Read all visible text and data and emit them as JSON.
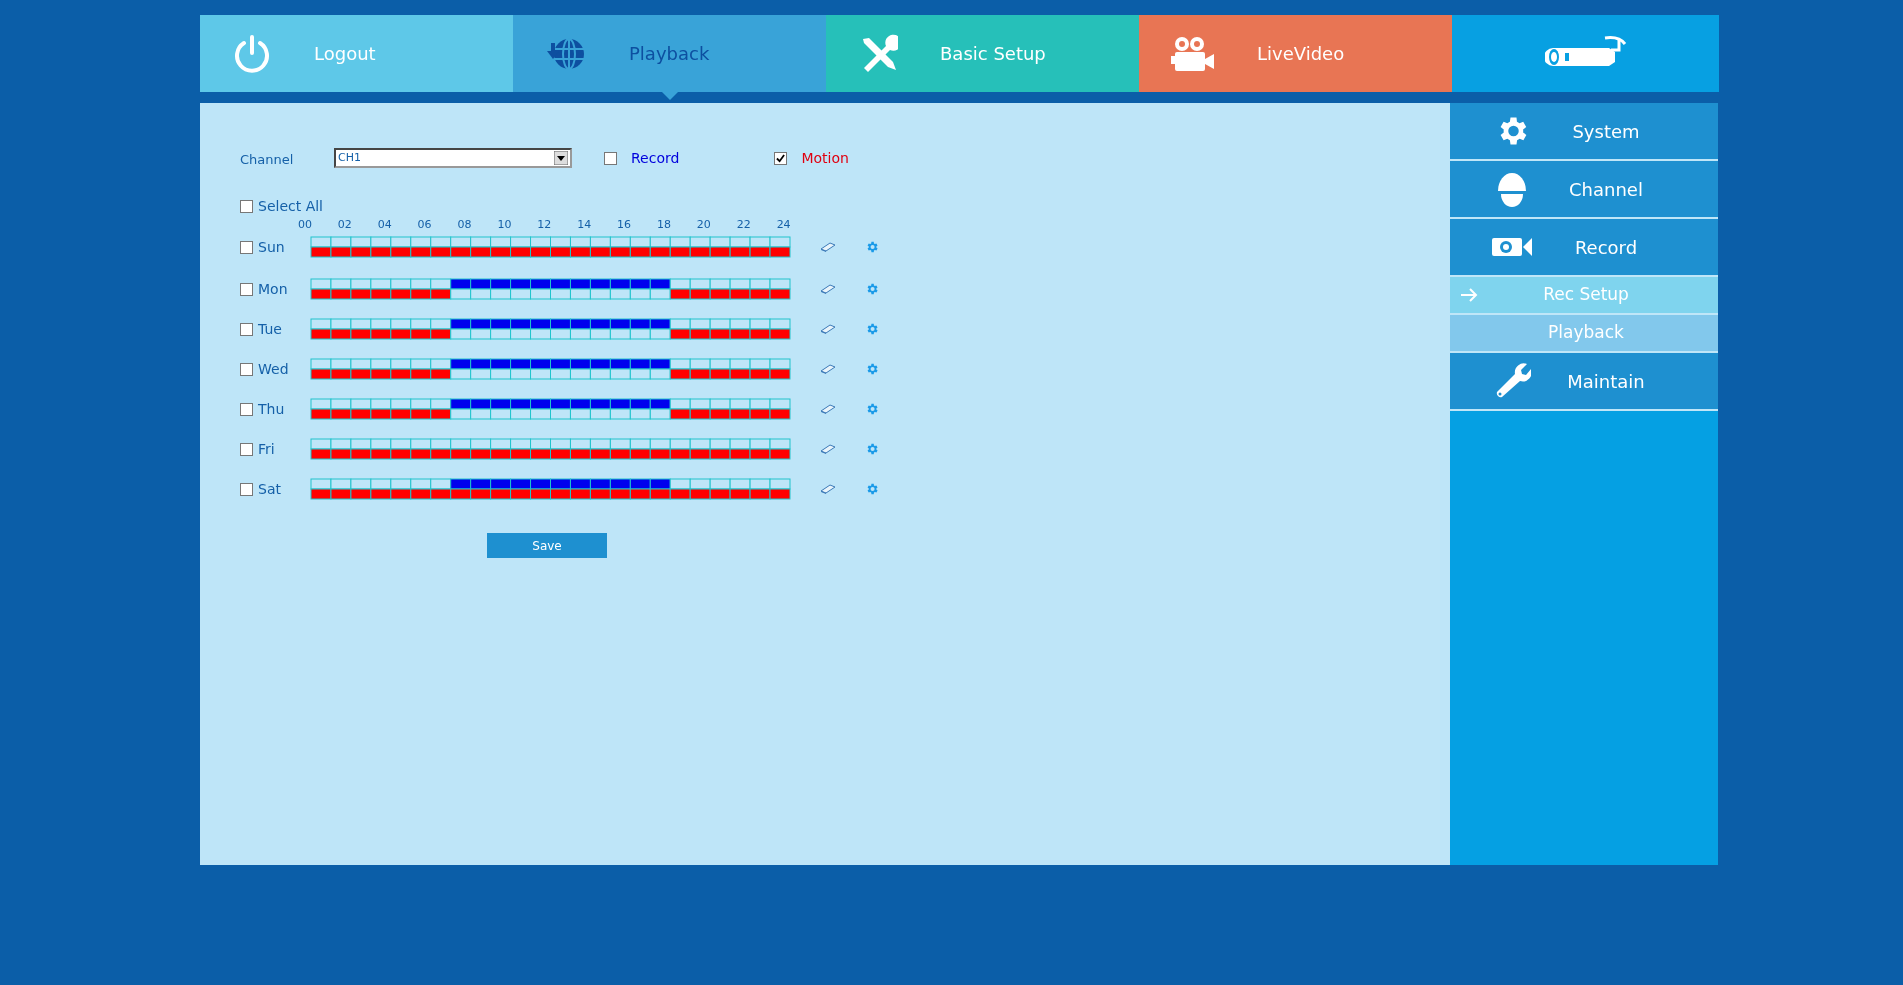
{
  "tabs": [
    {
      "label": "Logout",
      "selected": false,
      "color": "#5ec8e8"
    },
    {
      "label": "Playback",
      "selected": true,
      "color": "#39a3d8"
    },
    {
      "label": "Basic Setup",
      "selected": false,
      "color": "#26c0b9"
    },
    {
      "label": "LiveVideo",
      "selected": false,
      "color": "#e87554"
    },
    {
      "selected": false,
      "color": "#07a0e2"
    }
  ],
  "channel": {
    "label": "Channel",
    "value": "CH1"
  },
  "types": [
    {
      "label": "Record",
      "kind": "record",
      "checked": false
    },
    {
      "label": "Motion",
      "kind": "motion",
      "checked": true
    }
  ],
  "select_all": {
    "label": "Select All",
    "checked": false
  },
  "hours": [
    "00",
    "02",
    "04",
    "06",
    "08",
    "10",
    "12",
    "14",
    "16",
    "18",
    "20",
    "22",
    "24"
  ],
  "days": [
    {
      "label": "Sun",
      "checked": false,
      "record": [
        false,
        false,
        false,
        false,
        false,
        false,
        false,
        false,
        false,
        false,
        false,
        false,
        false,
        false,
        false,
        false,
        false,
        false,
        false,
        false,
        false,
        false,
        false,
        false
      ],
      "motion": [
        true,
        true,
        true,
        true,
        true,
        true,
        true,
        true,
        true,
        true,
        true,
        true,
        true,
        true,
        true,
        true,
        true,
        true,
        true,
        true,
        true,
        true,
        true,
        true
      ]
    },
    {
      "label": "Mon",
      "checked": false,
      "record": [
        false,
        false,
        false,
        false,
        false,
        false,
        false,
        true,
        true,
        true,
        true,
        true,
        true,
        true,
        true,
        true,
        true,
        true,
        false,
        false,
        false,
        false,
        false,
        false
      ],
      "motion": [
        true,
        true,
        true,
        true,
        true,
        true,
        true,
        false,
        false,
        false,
        false,
        false,
        false,
        false,
        false,
        false,
        false,
        false,
        true,
        true,
        true,
        true,
        true,
        true
      ]
    },
    {
      "label": "Tue",
      "checked": false,
      "record": [
        false,
        false,
        false,
        false,
        false,
        false,
        false,
        true,
        true,
        true,
        true,
        true,
        true,
        true,
        true,
        true,
        true,
        true,
        false,
        false,
        false,
        false,
        false,
        false
      ],
      "motion": [
        true,
        true,
        true,
        true,
        true,
        true,
        true,
        false,
        false,
        false,
        false,
        false,
        false,
        false,
        false,
        false,
        false,
        false,
        true,
        true,
        true,
        true,
        true,
        true
      ]
    },
    {
      "label": "Wed",
      "checked": false,
      "record": [
        false,
        false,
        false,
        false,
        false,
        false,
        false,
        true,
        true,
        true,
        true,
        true,
        true,
        true,
        true,
        true,
        true,
        true,
        false,
        false,
        false,
        false,
        false,
        false
      ],
      "motion": [
        true,
        true,
        true,
        true,
        true,
        true,
        true,
        false,
        false,
        false,
        false,
        false,
        false,
        false,
        false,
        false,
        false,
        false,
        true,
        true,
        true,
        true,
        true,
        true
      ]
    },
    {
      "label": "Thu",
      "checked": false,
      "record": [
        false,
        false,
        false,
        false,
        false,
        false,
        false,
        true,
        true,
        true,
        true,
        true,
        true,
        true,
        true,
        true,
        true,
        true,
        false,
        false,
        false,
        false,
        false,
        false
      ],
      "motion": [
        true,
        true,
        true,
        true,
        true,
        true,
        true,
        false,
        false,
        false,
        false,
        false,
        false,
        false,
        false,
        false,
        false,
        false,
        true,
        true,
        true,
        true,
        true,
        true
      ]
    },
    {
      "label": "Fri",
      "checked": false,
      "record": [
        false,
        false,
        false,
        false,
        false,
        false,
        false,
        false,
        false,
        false,
        false,
        false,
        false,
        false,
        false,
        false,
        false,
        false,
        false,
        false,
        false,
        false,
        false,
        false
      ],
      "motion": [
        true,
        true,
        true,
        true,
        true,
        true,
        true,
        true,
        true,
        true,
        true,
        true,
        true,
        true,
        true,
        true,
        true,
        true,
        true,
        true,
        true,
        true,
        true,
        true
      ]
    },
    {
      "label": "Sat",
      "checked": false,
      "record": [
        false,
        false,
        false,
        false,
        false,
        false,
        false,
        true,
        true,
        true,
        true,
        true,
        true,
        true,
        true,
        true,
        true,
        true,
        false,
        false,
        false,
        false,
        false,
        false
      ],
      "motion": [
        true,
        true,
        true,
        true,
        true,
        true,
        true,
        true,
        true,
        true,
        true,
        true,
        true,
        true,
        true,
        true,
        true,
        true,
        true,
        true,
        true,
        true,
        true,
        true
      ]
    }
  ],
  "save": "Save",
  "sidebar": [
    {
      "label": "System",
      "kind": "main"
    },
    {
      "label": "Channel",
      "kind": "main"
    },
    {
      "label": "Record",
      "kind": "main"
    },
    {
      "label": "Rec Setup",
      "kind": "sub",
      "selected": true
    },
    {
      "label": "Playback",
      "kind": "sub",
      "selected": false
    },
    {
      "label": "Maintain",
      "kind": "main"
    }
  ]
}
